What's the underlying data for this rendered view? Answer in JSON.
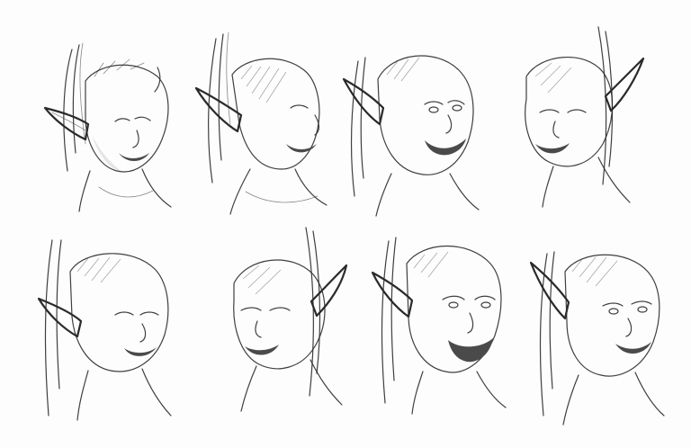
{
  "sheet": {
    "heads": [
      {
        "id": "head-1",
        "expression": "eyes-closed-smirk",
        "facing": "down-right"
      },
      {
        "id": "head-2",
        "expression": "side-profile-smile",
        "facing": "right"
      },
      {
        "id": "head-3",
        "expression": "open-laugh",
        "facing": "right"
      },
      {
        "id": "head-4",
        "expression": "sly-smile",
        "facing": "down-left"
      },
      {
        "id": "head-5",
        "expression": "eyes-closed-smug",
        "facing": "right"
      },
      {
        "id": "head-6",
        "expression": "mischievous-grin",
        "facing": "left"
      },
      {
        "id": "head-7",
        "expression": "wide-laugh",
        "facing": "front"
      },
      {
        "id": "head-8",
        "expression": "upward-smile",
        "facing": "up-right"
      }
    ],
    "colors": {
      "ink": "#2a2a2a",
      "paper": "#fdfdfd",
      "shade": "#cfcfcf"
    }
  }
}
